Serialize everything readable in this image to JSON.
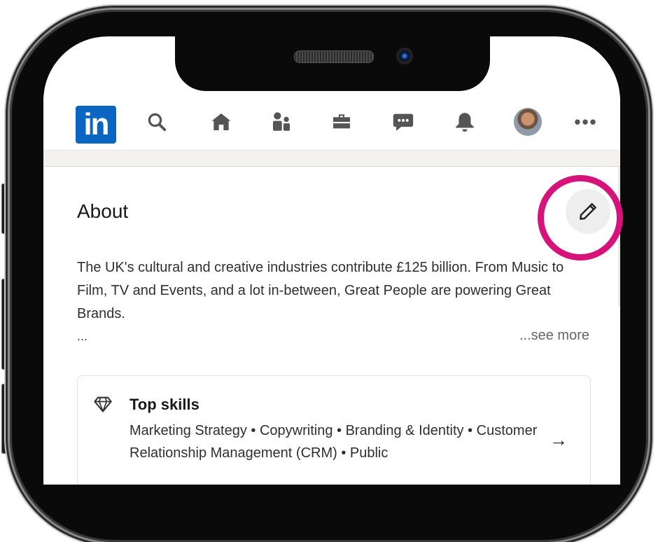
{
  "navbar": {
    "logo_text": "in",
    "icons": [
      "search-icon",
      "home-icon",
      "my-network-icon",
      "jobs-icon",
      "messaging-icon",
      "notifications-icon",
      "profile-avatar",
      "more-icon"
    ],
    "more_label": "•••"
  },
  "about": {
    "title": "About",
    "text": "The UK's cultural and creative industries contribute £125 billion. From Music to Film, TV and Events, and a lot in-between, Great People are powering Great Brands.",
    "ellipsis": "...",
    "see_more": "...see more",
    "edit_icon": "pencil-icon"
  },
  "skills": {
    "icon": "diamond-icon",
    "title": "Top skills",
    "list": "Marketing Strategy • Copywriting • Branding & Identity • Customer Relationship Management (CRM) • Public",
    "arrow": "→"
  },
  "colors": {
    "linkedin_blue": "#0a66c2",
    "highlight": "#d6127b"
  }
}
